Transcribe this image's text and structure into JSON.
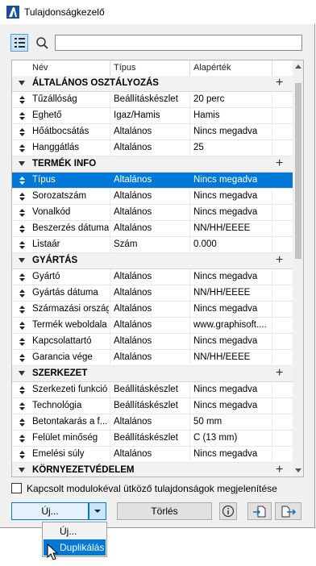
{
  "window": {
    "title": "Tulajdonságkezelő"
  },
  "search": {
    "value": "",
    "placeholder": ""
  },
  "table": {
    "columns": [
      "Név",
      "Típus",
      "Alapérték"
    ],
    "groups": [
      {
        "name": "ÁLTALÁNOS OSZTÁLYOZÁS",
        "rows": [
          {
            "name": "Tűzállóság",
            "type": "Beállításkészlet",
            "value": "20 perc"
          },
          {
            "name": "Éghető",
            "type": "Igaz/Hamis",
            "value": "Hamis"
          },
          {
            "name": "Hőátbocsátás",
            "type": "Általános",
            "value": "Nincs megadva"
          },
          {
            "name": "Hanggátlás",
            "type": "Általános",
            "value": "25"
          }
        ]
      },
      {
        "name": "TERMÉK INFO",
        "rows": [
          {
            "name": "Típus",
            "type": "Általános",
            "value": "Nincs megadva",
            "selected": true
          },
          {
            "name": "Sorozatszám",
            "type": "Általános",
            "value": "Nincs megadva"
          },
          {
            "name": "Vonalkód",
            "type": "Általános",
            "value": "Nincs megadva"
          },
          {
            "name": "Beszerzés dátuma",
            "type": "Általános",
            "value": "NN/HH/ÉÉÉÉ"
          },
          {
            "name": "Listaár",
            "type": "Szám",
            "value": "0.000"
          }
        ]
      },
      {
        "name": "GYÁRTÁS",
        "rows": [
          {
            "name": "Gyártó",
            "type": "Általános",
            "value": "Nincs megadva"
          },
          {
            "name": "Gyártás dátuma",
            "type": "Általános",
            "value": "NN/HH/ÉÉÉÉ"
          },
          {
            "name": "Származási ország",
            "type": "Általános",
            "value": "Nincs megadva"
          },
          {
            "name": "Termék weboldala",
            "type": "Általános",
            "value": "www.graphisoft...."
          },
          {
            "name": "Kapcsolattartó",
            "type": "Általános",
            "value": "Nincs megadva"
          },
          {
            "name": "Garancia vége",
            "type": "Általános",
            "value": "NN/HH/ÉÉÉÉ"
          }
        ]
      },
      {
        "name": "SZERKEZET",
        "rows": [
          {
            "name": "Szerkezeti funkció",
            "type": "Beállításkészlet",
            "value": "Nincs megadva"
          },
          {
            "name": "Technológia",
            "type": "Beállításkészlet",
            "value": "Nincs megadva"
          },
          {
            "name": "Betontakarás a f...",
            "type": "Általános",
            "value": "50 mm"
          },
          {
            "name": "Felület minőség",
            "type": "Beállításkészlet",
            "value": "C (13 mm)"
          },
          {
            "name": "Emelési súly",
            "type": "Általános",
            "value": "Nincs megadva"
          }
        ]
      },
      {
        "name": "KÖRNYEZETVÉDELEM",
        "rows": []
      }
    ]
  },
  "checkbox": {
    "label": "Kapcsolt modulokéval ütköző tulajdonságok megjelenítése",
    "checked": false
  },
  "buttons": {
    "new": "Új...",
    "delete": "Törlés"
  },
  "menu": {
    "items": [
      "Új...",
      "Duplikálás"
    ],
    "highlighted": "Duplikálás"
  },
  "icons": [
    "app-icon",
    "list-view-icon",
    "search-icon",
    "sort-icon",
    "collapse-arrow-icon",
    "add-icon",
    "chevron-down-icon",
    "info-icon",
    "import-icon",
    "export-icon",
    "cursor-icon"
  ],
  "colors": {
    "selection": "#0078d7",
    "window_bg": "#f0f0f0"
  }
}
